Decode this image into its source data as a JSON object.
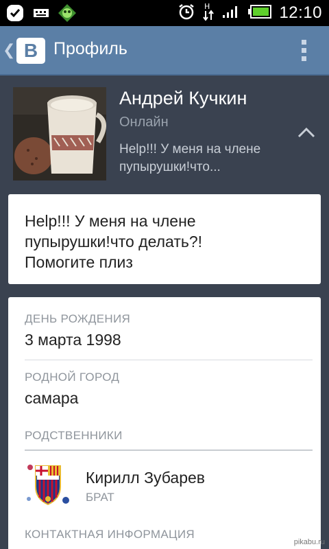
{
  "status_bar": {
    "time": "12:10",
    "icons": [
      "check-notification-icon",
      "keyboard-icon",
      "game-app-icon",
      "alarm-icon",
      "data-transfer-icon",
      "signal-icon",
      "battery-icon"
    ]
  },
  "app_bar": {
    "logo": "В",
    "title": "Профиль",
    "back_icon": "back-chevron-icon",
    "menu_icon": "overflow-menu-icon"
  },
  "profile": {
    "name": "Андрей Кучкин",
    "presence": "Онлайн",
    "status_preview_line1": "Help!!! У меня на члене",
    "status_preview_line2": "пупырушки!что..."
  },
  "status": {
    "line1": "Help!!! У меня на члене",
    "line2": "пупырушки!что делать?!",
    "line3": "Помогите плиз"
  },
  "info": {
    "birthday_label": "ДЕНЬ РОЖДЕНИЯ",
    "birthday_value": "3 марта 1998",
    "hometown_label": "РОДНОЙ ГОРОД",
    "hometown_value": "самара",
    "relatives_label": "РОДСТВЕННИКИ",
    "relative": {
      "name": "Кирилл Зубарев",
      "role": "БРАТ"
    },
    "contacts_label": "КОНТАКТНАЯ ИНФОРМАЦИЯ"
  },
  "watermark": "pikabu.ru",
  "colors": {
    "app_bar": "#5b7fa6",
    "background": "#3a4250",
    "card": "#ffffff"
  }
}
